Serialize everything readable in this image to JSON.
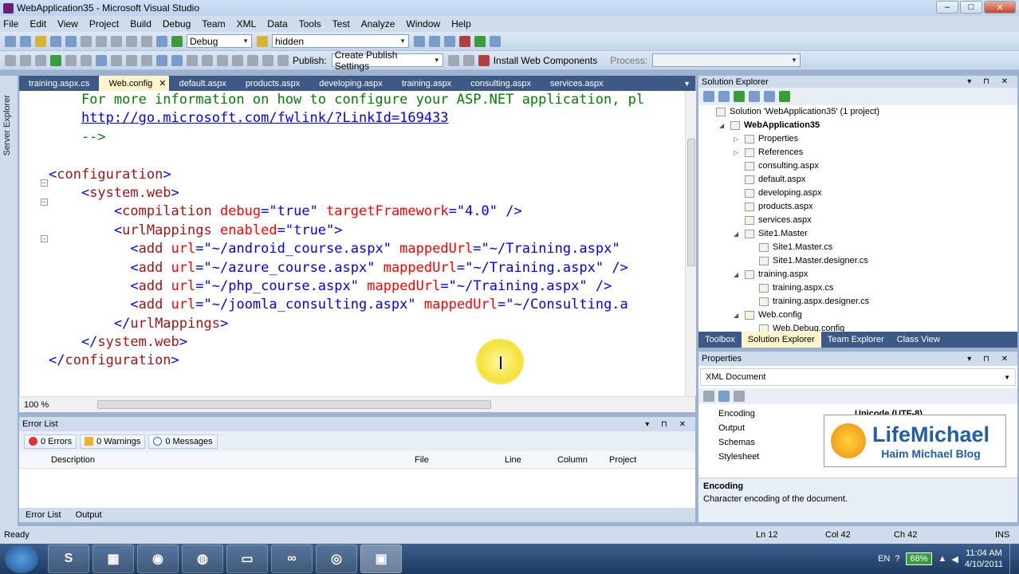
{
  "window": {
    "title": "WebApplication35 - Microsoft Visual Studio",
    "min": "–",
    "max": "□",
    "close": "✕"
  },
  "menu": [
    "File",
    "Edit",
    "View",
    "Project",
    "Build",
    "Debug",
    "Team",
    "XML",
    "Data",
    "Tools",
    "Test",
    "Analyze",
    "Window",
    "Help"
  ],
  "toolbar": {
    "config": "Debug",
    "find": "hidden",
    "publish_label": "Publish:",
    "publish_value": "Create Publish Settings",
    "install": "Install Web Components",
    "process_label": "Process:"
  },
  "side_tab": "Server Explorer",
  "doc_tabs": [
    "training.aspx.cs",
    "Web.config",
    "default.aspx",
    "products.aspx",
    "developing.aspx",
    "training.aspx",
    "consulting.aspx",
    "services.aspx"
  ],
  "code_lines": [
    [
      {
        "t": "    For more information on how to configure your ASP.NET application, pl",
        "c": "c-com"
      }
    ],
    [
      {
        "t": "    ",
        "c": ""
      },
      {
        "t": "http://go.microsoft.com/fwlink/?LinkId=169433",
        "c": "c-link"
      }
    ],
    [
      {
        "t": "    -->",
        "c": "c-com"
      }
    ],
    [
      {
        "t": "",
        "c": ""
      }
    ],
    [
      {
        "t": "<",
        "c": "c-br"
      },
      {
        "t": "configuration",
        "c": "c-tag"
      },
      {
        "t": ">",
        "c": "c-br"
      }
    ],
    [
      {
        "t": "    <",
        "c": "c-br"
      },
      {
        "t": "system.web",
        "c": "c-tag"
      },
      {
        "t": ">",
        "c": "c-br"
      }
    ],
    [
      {
        "t": "        <",
        "c": "c-br"
      },
      {
        "t": "compilation",
        "c": "c-tag"
      },
      {
        "t": " debug",
        "c": "c-attr"
      },
      {
        "t": "=\"",
        "c": "c-br"
      },
      {
        "t": "true",
        "c": "c-val"
      },
      {
        "t": "\"",
        "c": "c-br"
      },
      {
        "t": " targetFramework",
        "c": "c-attr"
      },
      {
        "t": "=\"",
        "c": "c-br"
      },
      {
        "t": "4.0",
        "c": "c-val"
      },
      {
        "t": "\" />",
        "c": "c-br"
      }
    ],
    [
      {
        "t": "        <",
        "c": "c-br"
      },
      {
        "t": "urlMappings",
        "c": "c-tag"
      },
      {
        "t": " enabled",
        "c": "c-attr"
      },
      {
        "t": "=\"",
        "c": "c-br"
      },
      {
        "t": "true",
        "c": "c-val"
      },
      {
        "t": "\">",
        "c": "c-br"
      }
    ],
    [
      {
        "t": "          <",
        "c": "c-br"
      },
      {
        "t": "add",
        "c": "c-tag"
      },
      {
        "t": " url",
        "c": "c-attr"
      },
      {
        "t": "=\"",
        "c": "c-br"
      },
      {
        "t": "~/android_course.aspx",
        "c": "c-val"
      },
      {
        "t": "\"",
        "c": "c-br"
      },
      {
        "t": " mappedUrl",
        "c": "c-attr"
      },
      {
        "t": "=\"",
        "c": "c-br"
      },
      {
        "t": "~/Training.aspx",
        "c": "c-val"
      },
      {
        "t": "\"",
        "c": "c-br"
      }
    ],
    [
      {
        "t": "          <",
        "c": "c-br"
      },
      {
        "t": "add",
        "c": "c-tag"
      },
      {
        "t": " url",
        "c": "c-attr"
      },
      {
        "t": "=\"",
        "c": "c-br"
      },
      {
        "t": "~/azure_course.aspx",
        "c": "c-val"
      },
      {
        "t": "\"",
        "c": "c-br"
      },
      {
        "t": " mappedUrl",
        "c": "c-attr"
      },
      {
        "t": "=\"",
        "c": "c-br"
      },
      {
        "t": "~/Training.aspx",
        "c": "c-val"
      },
      {
        "t": "\" />",
        "c": "c-br"
      }
    ],
    [
      {
        "t": "          <",
        "c": "c-br"
      },
      {
        "t": "add",
        "c": "c-tag"
      },
      {
        "t": " url",
        "c": "c-attr"
      },
      {
        "t": "=\"",
        "c": "c-br"
      },
      {
        "t": "~/php_course.aspx",
        "c": "c-val"
      },
      {
        "t": "\"",
        "c": "c-br"
      },
      {
        "t": " mappedUrl",
        "c": "c-attr"
      },
      {
        "t": "=\"",
        "c": "c-br"
      },
      {
        "t": "~/Training.aspx",
        "c": "c-val"
      },
      {
        "t": "\" />",
        "c": "c-br"
      }
    ],
    [
      {
        "t": "          <",
        "c": "c-br"
      },
      {
        "t": "add",
        "c": "c-tag"
      },
      {
        "t": " url",
        "c": "c-attr"
      },
      {
        "t": "=\"",
        "c": "c-br"
      },
      {
        "t": "~/joomla_consulting.aspx",
        "c": "c-val"
      },
      {
        "t": "\"",
        "c": "c-br"
      },
      {
        "t": " mappedUrl",
        "c": "c-attr"
      },
      {
        "t": "=\"",
        "c": "c-br"
      },
      {
        "t": "~/Consulting.a",
        "c": "c-val"
      }
    ],
    [
      {
        "t": "        </",
        "c": "c-br"
      },
      {
        "t": "urlMappings",
        "c": "c-tag"
      },
      {
        "t": ">",
        "c": "c-br"
      }
    ],
    [
      {
        "t": "    </",
        "c": "c-br"
      },
      {
        "t": "system.web",
        "c": "c-tag"
      },
      {
        "t": ">",
        "c": "c-br"
      }
    ],
    [
      {
        "t": "</",
        "c": "c-br"
      },
      {
        "t": "configuration",
        "c": "c-tag"
      },
      {
        "t": ">",
        "c": "c-br"
      }
    ]
  ],
  "zoom": "100 %",
  "error_list": {
    "title": "Error List",
    "errors": "0 Errors",
    "warnings": "0 Warnings",
    "messages": "0 Messages",
    "columns": [
      "Description",
      "File",
      "Line",
      "Column",
      "Project"
    ]
  },
  "bottom_tabs": [
    "Error List",
    "Output"
  ],
  "solution_explorer": {
    "title": "Solution Explorer",
    "items": [
      {
        "label": "Solution 'WebApplication35' (1 project)",
        "bold": false
      },
      {
        "label": "WebApplication35",
        "bold": true
      },
      {
        "label": "Properties",
        "bold": false
      },
      {
        "label": "References",
        "bold": false
      },
      {
        "label": "consulting.aspx",
        "bold": false
      },
      {
        "label": "default.aspx",
        "bold": false
      },
      {
        "label": "developing.aspx",
        "bold": false
      },
      {
        "label": "products.aspx",
        "bold": false
      },
      {
        "label": "services.aspx",
        "bold": false
      },
      {
        "label": "Site1.Master",
        "bold": false
      },
      {
        "label": "Site1.Master.cs",
        "bold": false
      },
      {
        "label": "Site1.Master.designer.cs",
        "bold": false
      },
      {
        "label": "training.aspx",
        "bold": false
      },
      {
        "label": "training.aspx.cs",
        "bold": false
      },
      {
        "label": "training.aspx.designer.cs",
        "bold": false
      },
      {
        "label": "Web.config",
        "bold": false
      },
      {
        "label": "Web.Debug.config",
        "bold": false
      }
    ]
  },
  "panel_tabs": [
    "Toolbox",
    "Solution Explorer",
    "Team Explorer",
    "Class View"
  ],
  "properties": {
    "title": "Properties",
    "object": "XML Document",
    "rows": [
      "Encoding",
      "Output",
      "Schemas",
      "Stylesheet"
    ],
    "encoding_value": "Unicode (UTF-8)",
    "desc_title": "Encoding",
    "desc_text": "Character encoding of the document."
  },
  "watermark": {
    "line1": "LifeMichael",
    "line2": "Haim Michael Blog"
  },
  "status": {
    "ready": "Ready",
    "ln": "Ln 12",
    "col": "Col 42",
    "ch": "Ch 42",
    "ins": "INS"
  },
  "tray": {
    "lang": "EN",
    "battery": "68%",
    "time": "11:04 AM",
    "date": "4/10/2011"
  }
}
